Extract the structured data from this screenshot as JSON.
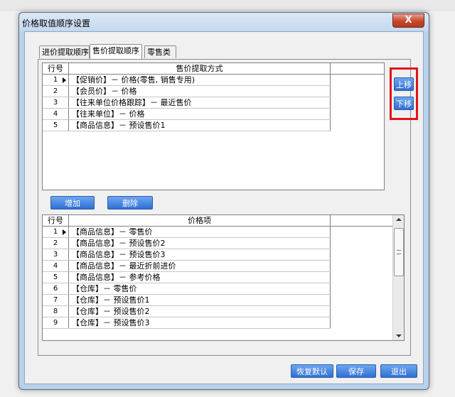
{
  "window": {
    "title": "价格取值顺序设置",
    "close_symbol": "X"
  },
  "tabs": [
    {
      "label": "进价提取顺序"
    },
    {
      "label": "售价提取顺序"
    },
    {
      "label": "零售类"
    }
  ],
  "top_table": {
    "headers": {
      "row": "行号",
      "col": "售价提取方式"
    },
    "rows": [
      {
        "num": "1",
        "text": "【促销价】－ 价格(零售, 销售专用)"
      },
      {
        "num": "2",
        "text": "【会员价】－ 价格"
      },
      {
        "num": "3",
        "text": "【往来单位价格跟踪】－ 最近售价"
      },
      {
        "num": "4",
        "text": "【往来单位】－ 价格"
      },
      {
        "num": "5",
        "text": "【商品信息】－ 预设售价1"
      }
    ]
  },
  "side_buttons": {
    "up": "上移",
    "down": "下移"
  },
  "mid_buttons": {
    "add": "增加",
    "delete": "删除"
  },
  "bottom_table": {
    "headers": {
      "row": "行号",
      "col": "价格项"
    },
    "rows": [
      {
        "num": "1",
        "text": "【商品信息】－ 零售价"
      },
      {
        "num": "2",
        "text": "【商品信息】－ 预设售价2"
      },
      {
        "num": "3",
        "text": "【商品信息】－ 预设售价3"
      },
      {
        "num": "4",
        "text": "【商品信息】－ 最近折前进价"
      },
      {
        "num": "5",
        "text": "【商品信息】－ 参考价格"
      },
      {
        "num": "6",
        "text": "【仓库】－ 零售价"
      },
      {
        "num": "7",
        "text": "【仓库】－ 预设售价1"
      },
      {
        "num": "8",
        "text": "【仓库】－ 预设售价2"
      },
      {
        "num": "9",
        "text": "【仓库】－ 预设售价3"
      }
    ]
  },
  "footer_buttons": {
    "restore": "恢复默认",
    "save": "保存",
    "exit": "退出"
  },
  "colors": {
    "button_blue": "#2f6fd3",
    "highlight_red": "#e0151c",
    "close_red": "#c7462a"
  }
}
